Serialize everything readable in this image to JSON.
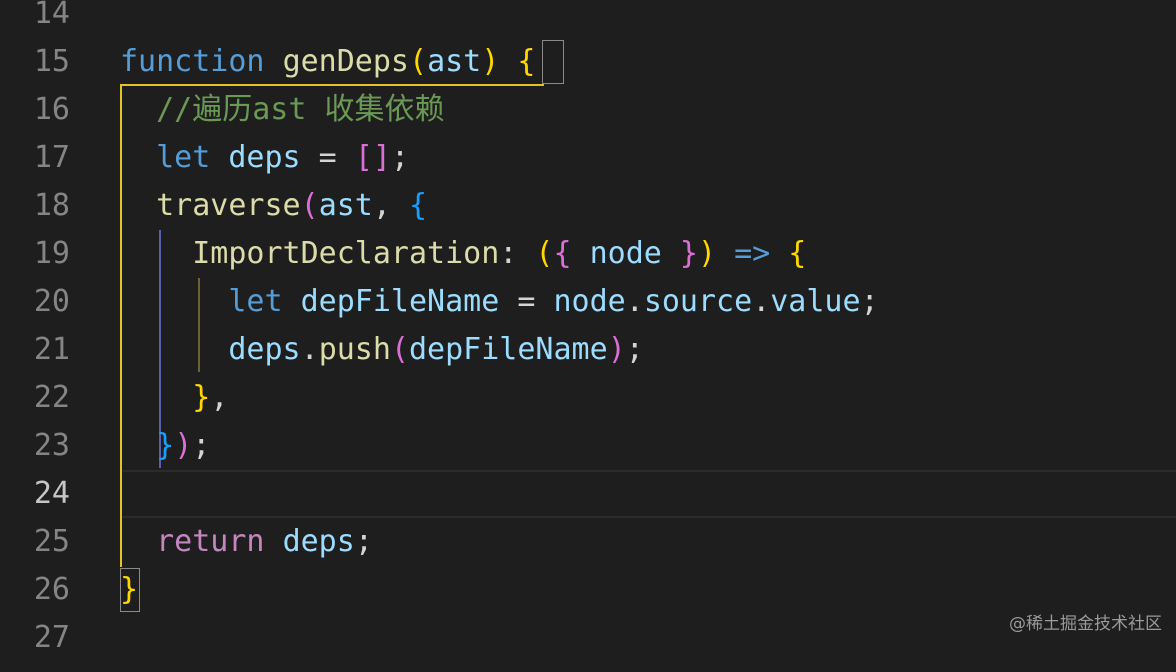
{
  "editor": {
    "lines": [
      {
        "number": "14"
      },
      {
        "number": "15",
        "tokens": [
          {
            "text": "function",
            "cls": "kw-blue"
          },
          {
            "text": " ",
            "cls": "punc"
          },
          {
            "text": "genDeps",
            "cls": "fn"
          },
          {
            "text": "(",
            "cls": "b1"
          },
          {
            "text": "ast",
            "cls": "var"
          },
          {
            "text": ")",
            "cls": "b1"
          },
          {
            "text": " ",
            "cls": "punc"
          },
          {
            "text": "{",
            "cls": "b1"
          }
        ]
      },
      {
        "number": "16",
        "tokens": [
          {
            "text": "  ",
            "cls": "punc"
          },
          {
            "text": "//遍历ast 收集依赖",
            "cls": "cmt"
          }
        ]
      },
      {
        "number": "17",
        "tokens": [
          {
            "text": "  ",
            "cls": "punc"
          },
          {
            "text": "let",
            "cls": "kw-blue"
          },
          {
            "text": " ",
            "cls": "punc"
          },
          {
            "text": "deps",
            "cls": "var"
          },
          {
            "text": " = ",
            "cls": "punc"
          },
          {
            "text": "[]",
            "cls": "b2"
          },
          {
            "text": ";",
            "cls": "punc"
          }
        ]
      },
      {
        "number": "18",
        "tokens": [
          {
            "text": "  ",
            "cls": "punc"
          },
          {
            "text": "traverse",
            "cls": "fn"
          },
          {
            "text": "(",
            "cls": "b2"
          },
          {
            "text": "ast",
            "cls": "var"
          },
          {
            "text": ", ",
            "cls": "punc"
          },
          {
            "text": "{",
            "cls": "b3"
          }
        ]
      },
      {
        "number": "19",
        "tokens": [
          {
            "text": "    ",
            "cls": "punc"
          },
          {
            "text": "ImportDeclaration",
            "cls": "fn"
          },
          {
            "text": ": ",
            "cls": "punc"
          },
          {
            "text": "(",
            "cls": "b1"
          },
          {
            "text": "{",
            "cls": "b2"
          },
          {
            "text": " ",
            "cls": "punc"
          },
          {
            "text": "node",
            "cls": "var"
          },
          {
            "text": " ",
            "cls": "punc"
          },
          {
            "text": "}",
            "cls": "b2"
          },
          {
            "text": ")",
            "cls": "b1"
          },
          {
            "text": " ",
            "cls": "punc"
          },
          {
            "text": "=>",
            "cls": "kw-blue"
          },
          {
            "text": " ",
            "cls": "punc"
          },
          {
            "text": "{",
            "cls": "b1"
          }
        ]
      },
      {
        "number": "20",
        "tokens": [
          {
            "text": "      ",
            "cls": "punc"
          },
          {
            "text": "let",
            "cls": "kw-blue"
          },
          {
            "text": " ",
            "cls": "punc"
          },
          {
            "text": "depFileName",
            "cls": "var"
          },
          {
            "text": " = ",
            "cls": "punc"
          },
          {
            "text": "node",
            "cls": "var"
          },
          {
            "text": ".",
            "cls": "punc"
          },
          {
            "text": "source",
            "cls": "prop"
          },
          {
            "text": ".",
            "cls": "punc"
          },
          {
            "text": "value",
            "cls": "prop"
          },
          {
            "text": ";",
            "cls": "punc"
          }
        ]
      },
      {
        "number": "21",
        "tokens": [
          {
            "text": "      ",
            "cls": "punc"
          },
          {
            "text": "deps",
            "cls": "var"
          },
          {
            "text": ".",
            "cls": "punc"
          },
          {
            "text": "push",
            "cls": "fn"
          },
          {
            "text": "(",
            "cls": "b2"
          },
          {
            "text": "depFileName",
            "cls": "var"
          },
          {
            "text": ")",
            "cls": "b2"
          },
          {
            "text": ";",
            "cls": "punc"
          }
        ]
      },
      {
        "number": "22",
        "tokens": [
          {
            "text": "    ",
            "cls": "punc"
          },
          {
            "text": "}",
            "cls": "b1"
          },
          {
            "text": ",",
            "cls": "punc"
          }
        ]
      },
      {
        "number": "23",
        "tokens": [
          {
            "text": "  ",
            "cls": "punc"
          },
          {
            "text": "}",
            "cls": "b3"
          },
          {
            "text": ")",
            "cls": "b2"
          },
          {
            "text": ";",
            "cls": "punc"
          }
        ]
      },
      {
        "number": "24",
        "active": true
      },
      {
        "number": "25",
        "tokens": [
          {
            "text": "  ",
            "cls": "punc"
          },
          {
            "text": "return",
            "cls": "kw-pink"
          },
          {
            "text": " ",
            "cls": "punc"
          },
          {
            "text": "deps",
            "cls": "var"
          },
          {
            "text": ";",
            "cls": "punc"
          }
        ]
      },
      {
        "number": "26",
        "tokens": [
          {
            "text": "}",
            "cls": "b1"
          }
        ]
      },
      {
        "number": "27"
      }
    ]
  },
  "watermark": "@稀土掘金技术社区",
  "colors": {
    "background": "#1e1e1e",
    "line_number": "#858585",
    "keyword": "#569cd6",
    "control_keyword": "#c586c0",
    "function": "#dcdcaa",
    "variable": "#9cdcfe",
    "comment": "#6a9955",
    "bracket_gold": "#ffd700",
    "bracket_pink": "#da70d6",
    "bracket_blue": "#179fff",
    "guide_active": "#e3c129"
  }
}
